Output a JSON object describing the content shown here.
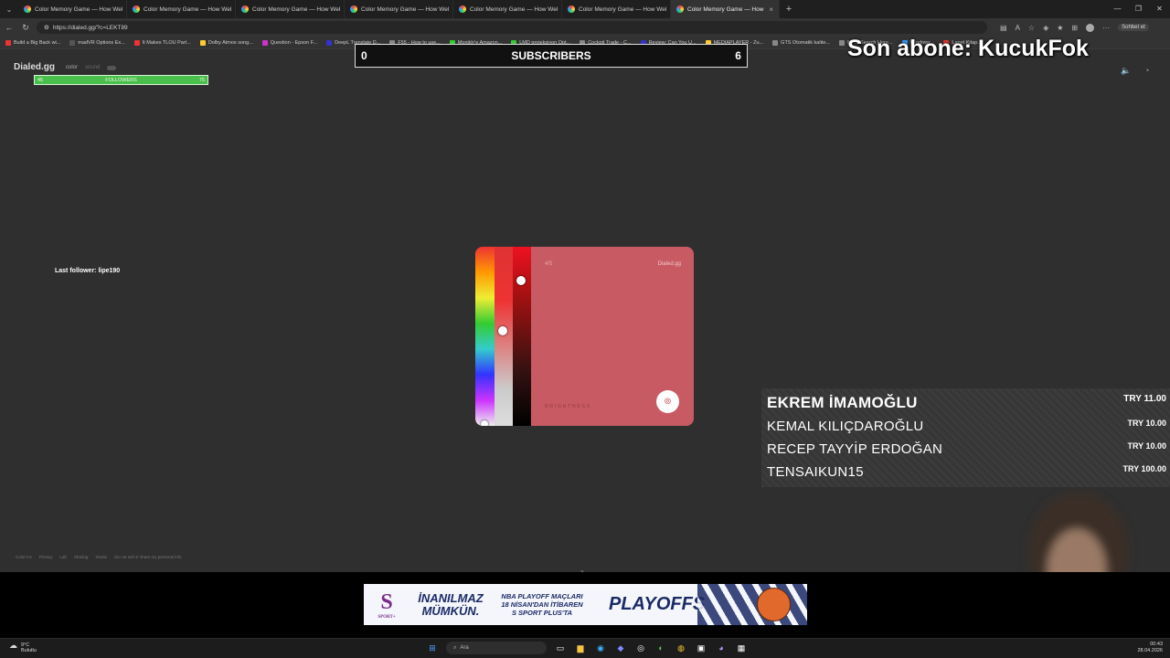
{
  "browser": {
    "tabs": [
      {
        "title": "Color Memory Game — How Wel",
        "active": false
      },
      {
        "title": "Color Memory Game — How Wel",
        "active": false
      },
      {
        "title": "Color Memory Game — How Wel",
        "active": false
      },
      {
        "title": "Color Memory Game — How Wel",
        "active": false
      },
      {
        "title": "Color Memory Game — How Wel",
        "active": false
      },
      {
        "title": "Color Memory Game — How Wel",
        "active": false
      },
      {
        "title": "Color Memory Game — How",
        "active": true
      }
    ],
    "url": "https://dialed.gg/?c=LEKT89",
    "chat_button": "Sohbet et",
    "bookmarks": [
      {
        "label": "Build a Big Back wi...",
        "color": "#e33"
      },
      {
        "label": "madVR Options Ex...",
        "color": "#555"
      },
      {
        "label": "It Makes TLOU Part...",
        "color": "#e33"
      },
      {
        "label": "Dolby Atmos song...",
        "color": "#fc3"
      },
      {
        "label": "Question - Epson F...",
        "color": "#c3c"
      },
      {
        "label": "DeepL Translate D...",
        "color": "#33c"
      },
      {
        "label": "F55 - How to use...",
        "color": "#888"
      },
      {
        "label": "Monitör'e Amazon...",
        "color": "#3c3"
      },
      {
        "label": "LMD projeksiyon Opt...",
        "color": "#3c3"
      },
      {
        "label": "Cockpit Trade - C...",
        "color": "#888"
      },
      {
        "label": "Review: Can You U...",
        "color": "#33c"
      },
      {
        "label": "MEDIAPLAYER - Zu...",
        "color": "#fc3"
      },
      {
        "label": "GTS Otomatik kalite...",
        "color": "#888"
      },
      {
        "label": "Nuitz Search Here...",
        "color": "#888"
      },
      {
        "label": "Windows...",
        "color": "#39f"
      },
      {
        "label": "Lanet Kitap...",
        "color": "#e33"
      }
    ]
  },
  "page": {
    "brand": "Dialed.gg",
    "nav_color": "color",
    "nav_sound": "sound",
    "footer": [
      "Color's 6",
      "Privacy",
      "Lab",
      "Sharing",
      "Studio",
      "Do not sell or share my personal info"
    ]
  },
  "overlay": {
    "followers_label": "FOLLOWERS",
    "followers_left": "45",
    "followers_right": "75",
    "last_follower": "Last follower: lipe190",
    "subs_left": "0",
    "subs_label": "SUBSCRIBERS",
    "subs_right": "6",
    "son_abone": "Son abone: KucukFok",
    "donations": [
      {
        "name": "EKREM İMAMOĞLU",
        "amount": "TRY 11.00"
      },
      {
        "name": "KEMAL KILIÇDAROĞLU",
        "amount": "TRY 10.00"
      },
      {
        "name": "RECEP TAYYİP ERDOĞAN",
        "amount": "TRY 10.00"
      },
      {
        "name": "TENSAIKUN15",
        "amount": "TRY 100.00"
      }
    ]
  },
  "game": {
    "round": "4/5",
    "brand": "Dialed.gg",
    "brightness_label": "BRIGHTNESS",
    "current_color": "#c75a63",
    "submit_icon": "fingerprint-icon"
  },
  "ad": {
    "brand_letter": "S",
    "brand_sub": "SPORT+",
    "slogan_line1": "İNANILMAZ",
    "slogan_line2": "MÜMKÜN.",
    "info_line1": "NBA PLAYOFF MAÇLARI",
    "info_line2": "18 NİSAN'DAN İTİBAREN",
    "info_line3": "S SPORT PLUS'TA",
    "playoffs": "PLAYOFFS"
  },
  "taskbar": {
    "temp": "9°C",
    "weather": "Bulutlu",
    "search_placeholder": "Ara",
    "time": "00:43",
    "date": "28.04.2026"
  }
}
